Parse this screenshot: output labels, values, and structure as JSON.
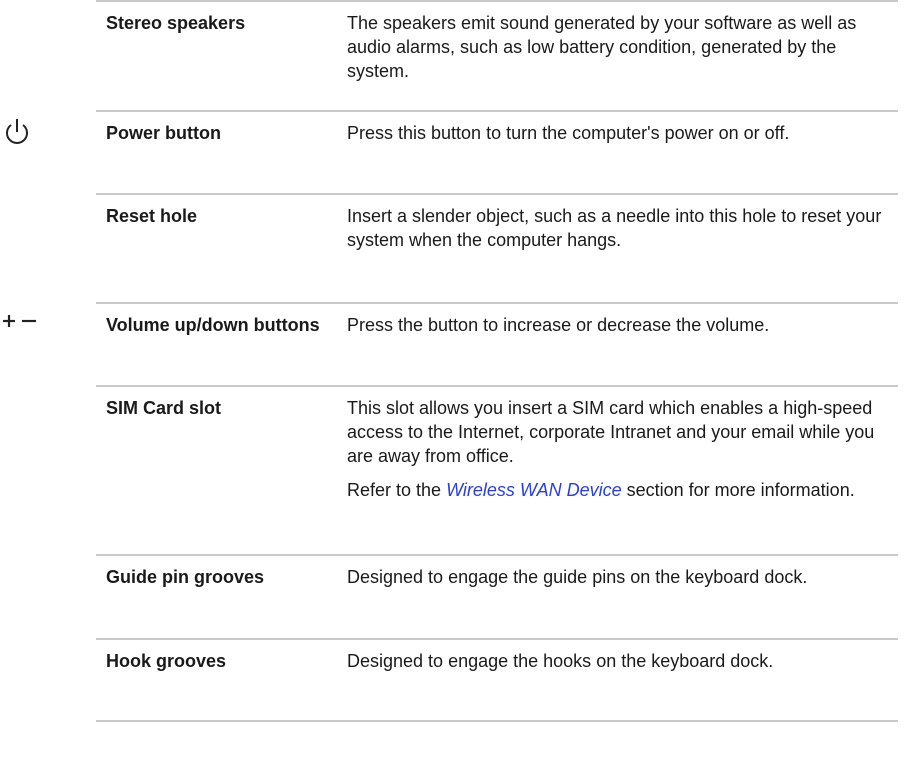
{
  "rows": [
    {
      "term": "Stereo speakers",
      "desc": [
        "The speakers emit sound generated by your software as well as audio alarms, such as low battery condition, generated by the system."
      ]
    },
    {
      "term": "Power button",
      "icon": "power-icon",
      "desc": [
        "Press this button to turn the computer's power on or off."
      ]
    },
    {
      "term": "Reset hole",
      "desc": [
        "Insert a slender object, such as a needle into this hole to reset your system when the computer hangs."
      ]
    },
    {
      "term": "Volume up/down buttons",
      "icon": "volume-plus-minus-icon",
      "desc": [
        "Press the button to increase or decrease the volume."
      ]
    },
    {
      "term": "SIM Card slot",
      "desc": [
        "This slot allows you insert a SIM card which enables a high-speed access to the Internet, corporate Intranet and your email while you are away from office."
      ],
      "refer_prefix": "Refer to the ",
      "refer_link": "Wireless WAN Device",
      "refer_suffix": " section for more information."
    },
    {
      "term": "Guide pin grooves",
      "desc": [
        "Designed to engage the guide pins on the keyboard dock."
      ]
    },
    {
      "term": "Hook grooves",
      "desc": [
        "Designed to engage the hooks on the keyboard dock."
      ]
    }
  ],
  "colors": {
    "rule": "#c9c9c9",
    "link": "#2a3fd6"
  }
}
